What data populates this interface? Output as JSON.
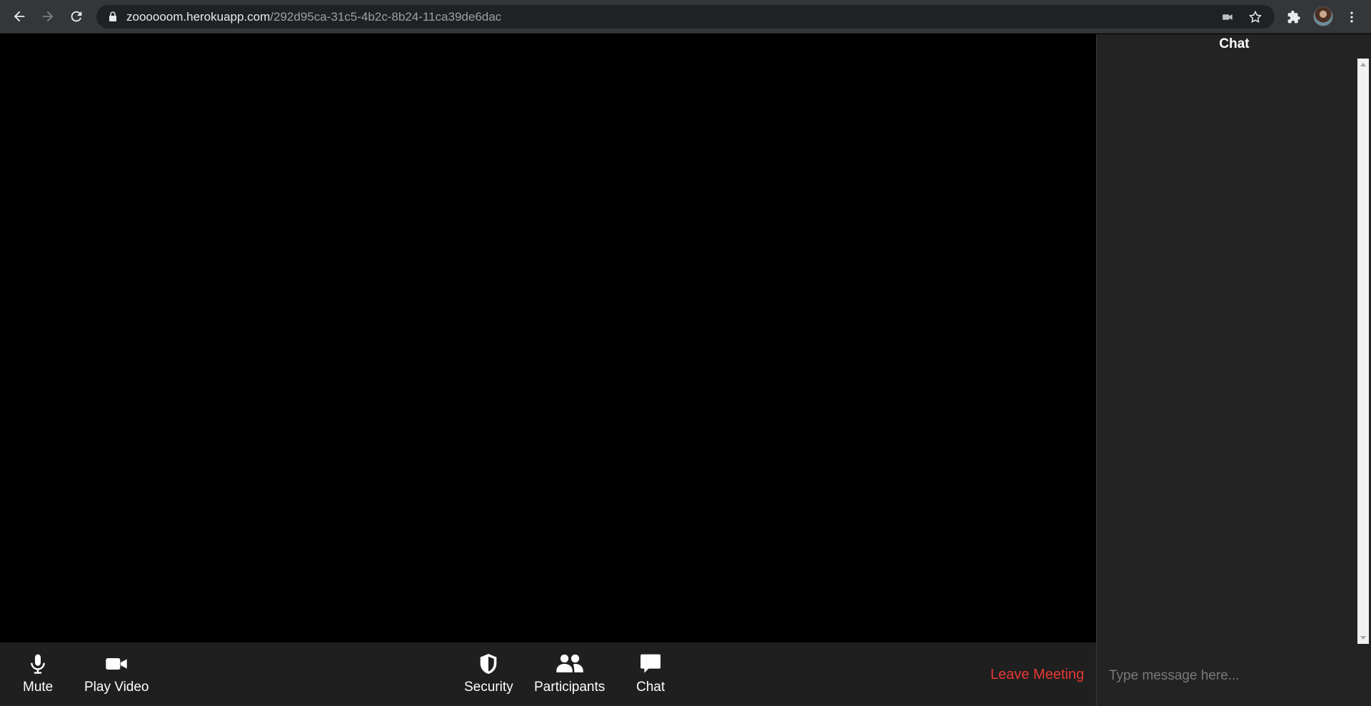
{
  "browser": {
    "url_host": "zoooooom.herokuapp.com",
    "url_path": "/292d95ca-31c5-4b2c-8b24-11ca39de6dac"
  },
  "toolbar": {
    "mute_label": "Mute",
    "play_video_label": "Play Video",
    "security_label": "Security",
    "participants_label": "Participants",
    "chat_label": "Chat",
    "leave_label": "Leave Meeting"
  },
  "chat": {
    "title": "Chat",
    "placeholder": "Type message here..."
  },
  "colors": {
    "leave": "#e53935",
    "toolbar_bg": "#1f1f1f",
    "chat_bg": "#232323"
  }
}
